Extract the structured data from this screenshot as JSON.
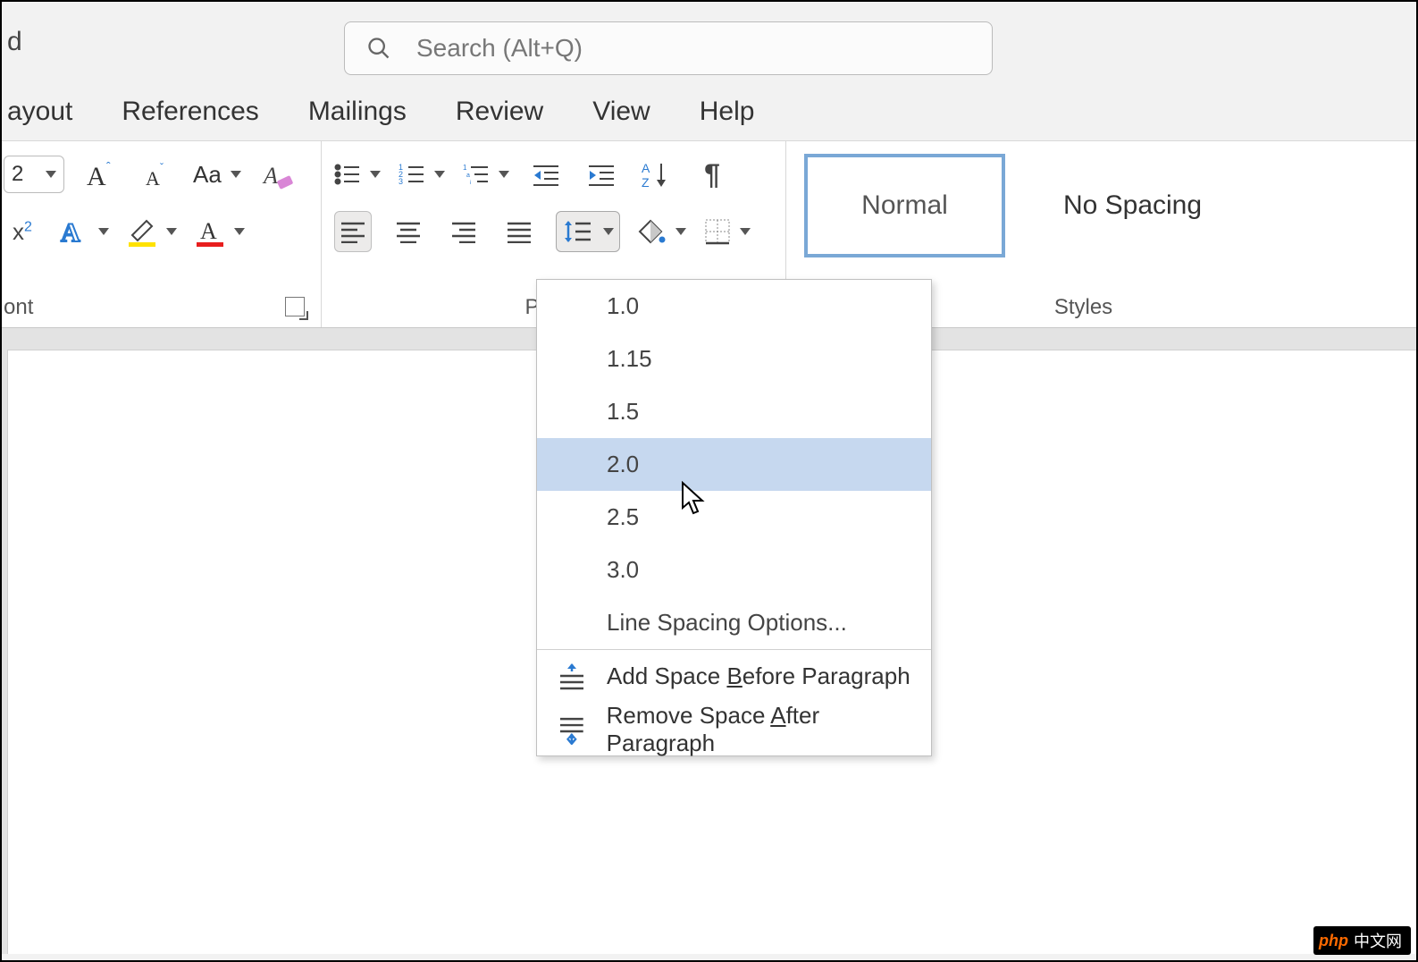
{
  "title_suffix": "d",
  "search": {
    "placeholder": "Search (Alt+Q)"
  },
  "tabs": {
    "layout": "ayout",
    "references": "References",
    "mailings": "Mailings",
    "review": "Review",
    "view": "View",
    "help": "Help"
  },
  "font": {
    "size_fragment": "2",
    "case_label": "Aa",
    "group_label": "ont"
  },
  "paragraph": {
    "group_label_partial": "Parag"
  },
  "styles": {
    "normal": "Normal",
    "no_spacing": "No Spacing",
    "group_label": "Styles"
  },
  "line_spacing_menu": {
    "options": [
      "1.0",
      "1.15",
      "1.5",
      "2.0",
      "2.5",
      "3.0"
    ],
    "highlighted_index": 3,
    "options_label": "Line Spacing Options...",
    "add_before_pre": "Add Space ",
    "add_before_key": "B",
    "add_before_post": "efore Paragraph",
    "remove_after_pre": "Remove Space ",
    "remove_after_key": "A",
    "remove_after_post": "fter Paragraph"
  },
  "watermark": {
    "php": "php",
    "rest": "中文网"
  }
}
